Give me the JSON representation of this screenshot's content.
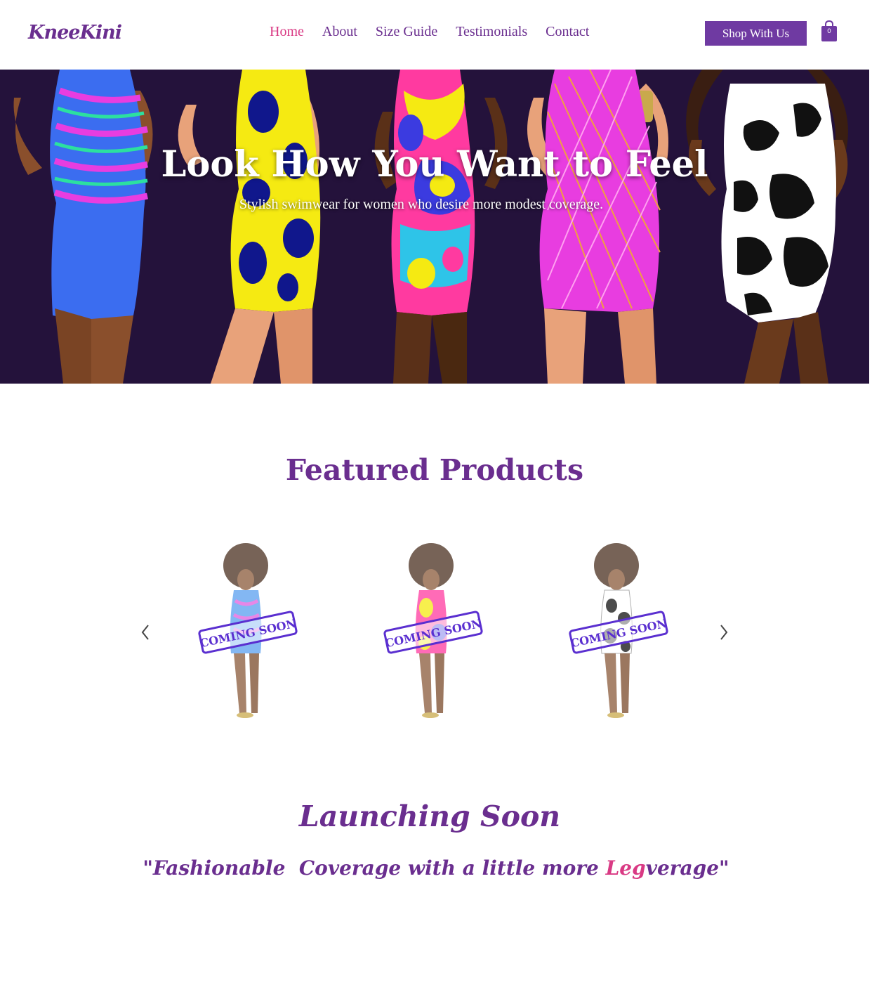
{
  "brand": {
    "logo_text": "KneeKini",
    "primary_color": "#6a2e8f",
    "accent_color": "#d93a84"
  },
  "nav": {
    "items": [
      {
        "label": "Home",
        "active": true
      },
      {
        "label": "About",
        "active": false
      },
      {
        "label": "Size Guide",
        "active": false
      },
      {
        "label": "Testimonials",
        "active": false
      },
      {
        "label": "Contact",
        "active": false
      }
    ]
  },
  "header": {
    "shop_button": "Shop With Us",
    "cart_count": "0",
    "cart_icon": "shopping-bag-icon"
  },
  "hero": {
    "title": "Look How You Want to Feel",
    "subtitle": "Stylish swimwear for women who desire more modest coverage."
  },
  "featured": {
    "title": "Featured Products",
    "prev_icon": "chevron-left-icon",
    "next_icon": "chevron-right-icon",
    "products": [
      {
        "stamp": "COMING SOON"
      },
      {
        "stamp": "COMING SOON"
      },
      {
        "stamp": "COMING SOON"
      }
    ]
  },
  "launch": {
    "title": "Launching Soon",
    "tagline_prefix": "\"Fashionable  Coverage with a little more ",
    "tagline_highlight": "Leg",
    "tagline_suffix": "verage\""
  }
}
